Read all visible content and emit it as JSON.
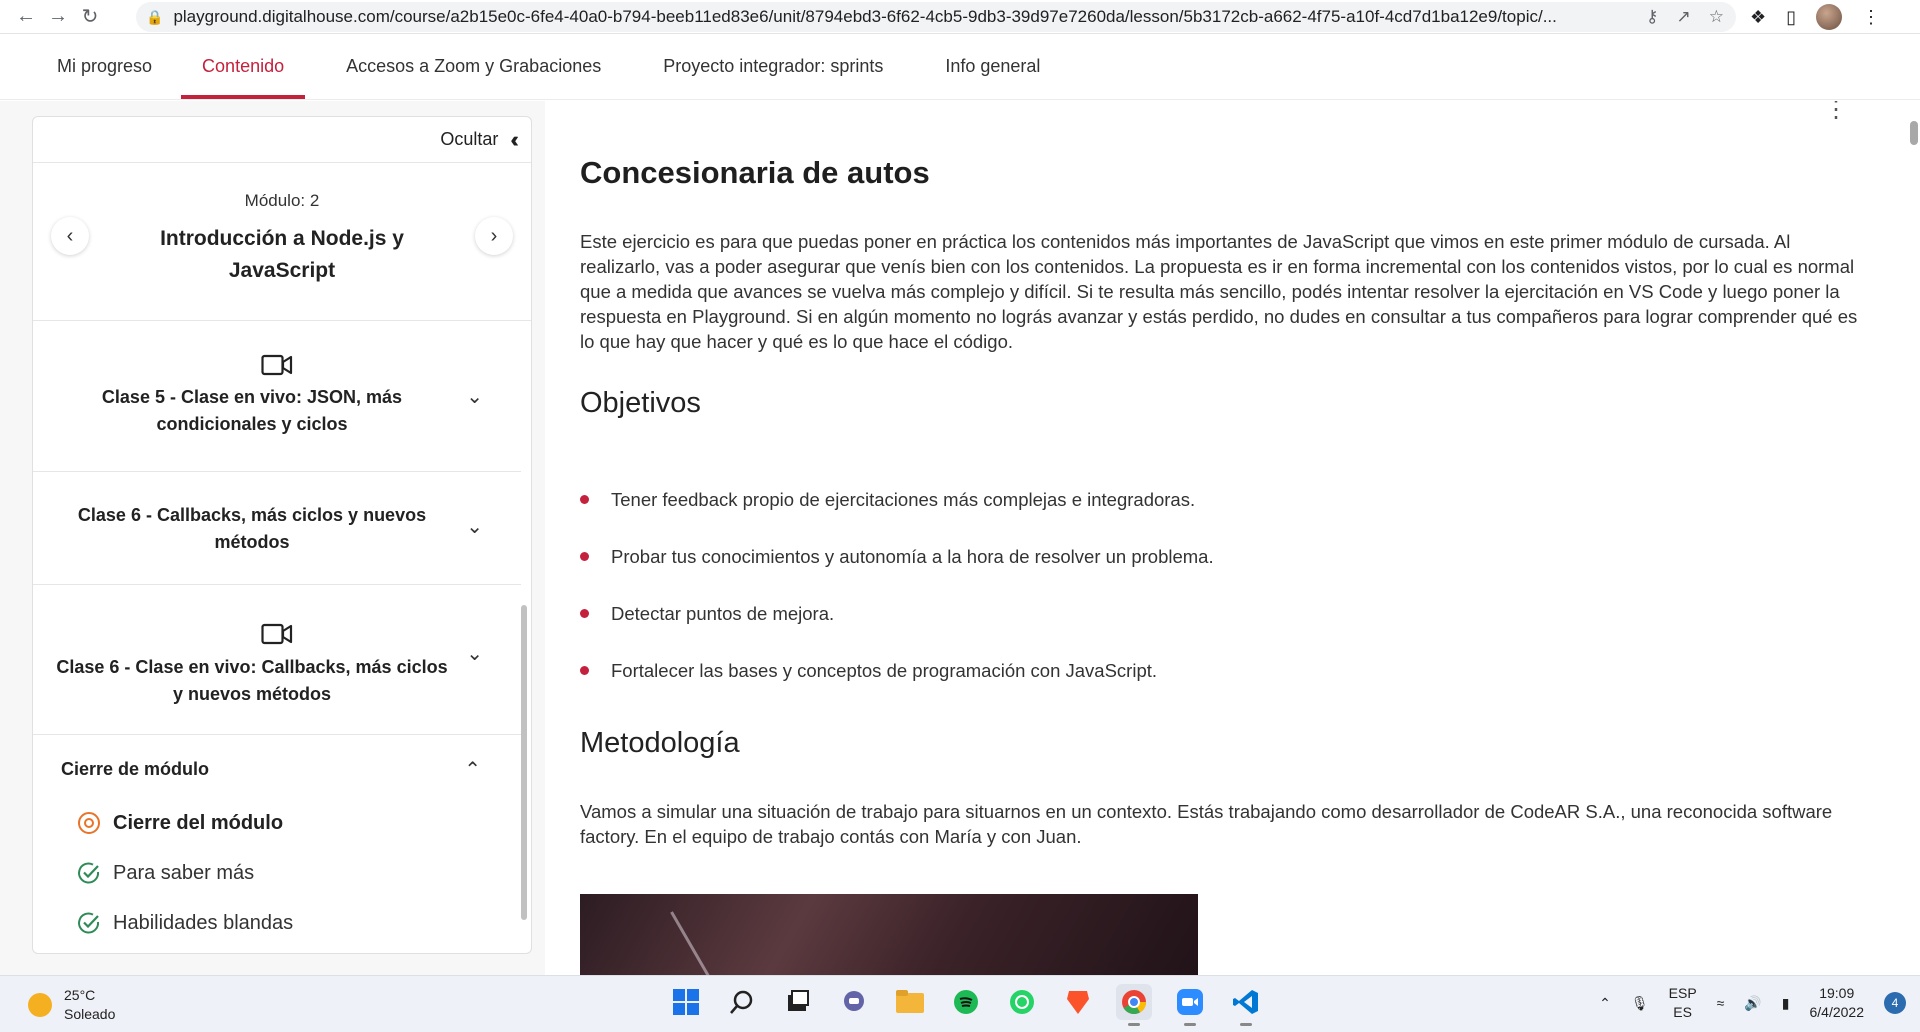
{
  "browser": {
    "url": "playground.digitalhouse.com/course/a2b15e0c-6fe4-40a0-b794-beeb11ed83e6/unit/8794ebd3-6f62-4cb5-9db3-39d97e7260da/lesson/5b3172cb-a662-4f75-a10f-4cd7d1ba12e9/topic/..."
  },
  "tabs": [
    "Mi progreso",
    "Contenido",
    "Accesos a Zoom y Grabaciones",
    "Proyecto integrador: sprints",
    "Info general"
  ],
  "sidebar": {
    "hide_label": "Ocultar",
    "module_label": "Módulo:",
    "module_number": "2",
    "module_title": "Introducción a Node.js y JavaScript",
    "classes": [
      {
        "title": "Clase 5 - Clase en vivo: JSON, más condicionales y ciclos",
        "icon": "video-camera-icon"
      },
      {
        "title": "Clase 6 - Callbacks, más ciclos y nuevos métodos",
        "icon": ""
      },
      {
        "title": "Clase 6 - Clase en vivo: Callbacks, más ciclos y nuevos métodos",
        "icon": "video-camera-icon"
      }
    ],
    "closing_section": "Cierre de módulo",
    "closing_items": [
      {
        "label": "Cierre del módulo",
        "status": "current"
      },
      {
        "label": "Para saber más",
        "status": "done"
      },
      {
        "label": "Habilidades blandas",
        "status": "done"
      }
    ]
  },
  "content": {
    "title": "Concesionaria de autos",
    "intro": "Este ejercicio es para que puedas poner en práctica los contenidos más importantes de JavaScript que vimos en este primer módulo de cursada. Al realizarlo, vas a poder asegurar que venís bien con los contenidos. La propuesta es ir en forma incremental con los contenidos vistos, por lo cual es normal que a medida que avances se vuelva más complejo y difícil. Si te resulta más sencillo, podés intentar resolver la ejercitación en VS Code y luego poner la respuesta en Playground. Si en algún momento no lográs avanzar y estás perdido, no dudes en consultar a tus compañeros para lograr comprender qué es lo que hay que hacer y qué es lo que hace el código.",
    "objectives_title": "Objetivos",
    "objectives": [
      "Tener feedback propio de ejercitaciones más complejas e integradoras.",
      "Probar tus conocimientos y autonomía a la hora de resolver un problema.",
      "Detectar puntos de mejora.",
      "Fortalecer las bases y conceptos de programación con JavaScript."
    ],
    "method_title": "Metodología",
    "method_text": "Vamos a simular una situación de trabajo para situarnos en un contexto. Estás trabajando como desarrollador de CodeAR S.A., una reconocida software factory. En el equipo de trabajo contás con María y con Juan."
  },
  "taskbar": {
    "temperature": "25°C",
    "weather": "Soleado",
    "lang_top": "ESP",
    "lang_bottom": "ES",
    "time": "19:09",
    "date": "6/4/2022",
    "notifications": "4"
  },
  "colors": {
    "accent": "#c4213d",
    "done": "#2e8b57",
    "current": "#e8742a"
  }
}
